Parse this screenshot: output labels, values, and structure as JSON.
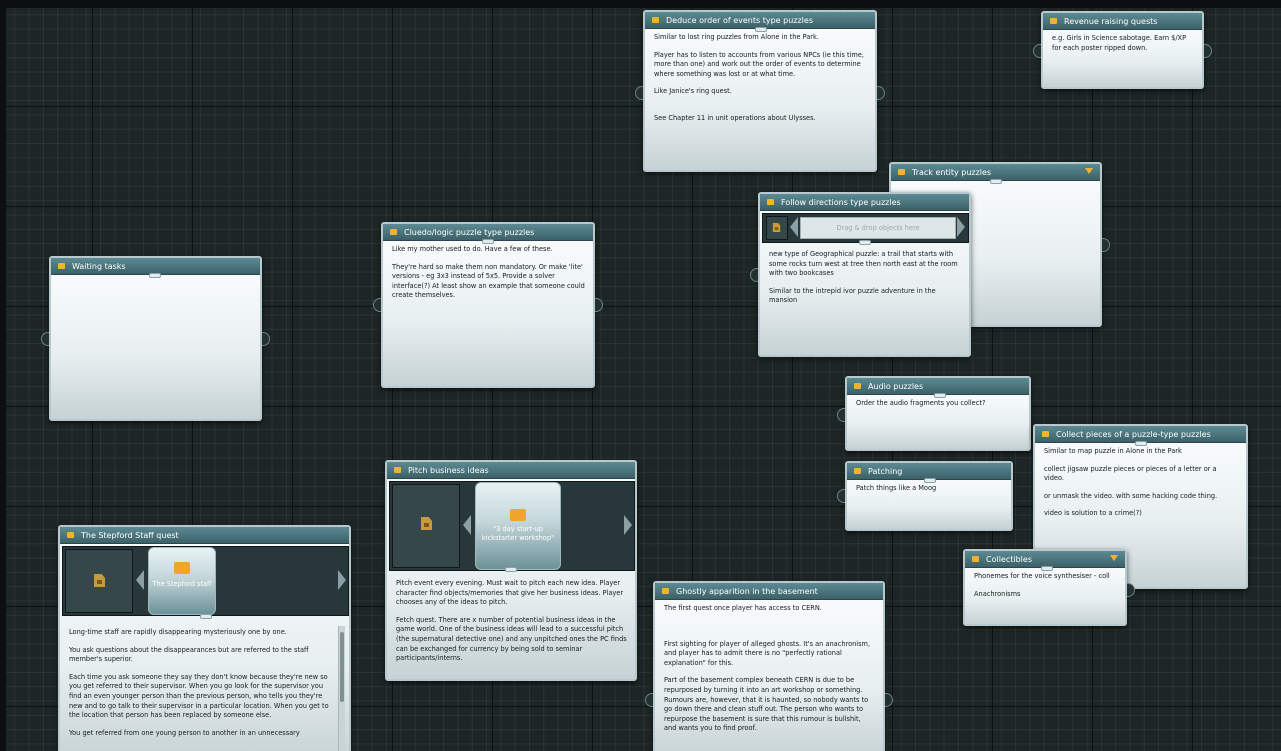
{
  "cards": {
    "waiting": {
      "title": "Waiting tasks"
    },
    "cluedo": {
      "title": "Cluedo/logic puzzle type puzzles",
      "paragraphs": [
        "Like my mother used to do. Have a few of these.",
        "They're hard so make them non mandatory. Or make 'lite' versions - eg 3x3 instead of 5x5. Provide a solver interface(?) At least show an example that someone could create themselves."
      ]
    },
    "deduce": {
      "title": "Deduce order of events type puzzles",
      "paragraphs": [
        "Similar to lost ring puzzles from Alone in the Park.",
        "Player has to listen to accounts from various NPCs (ie this time, more than one) and work out the order of events to determine where something was lost or at what time.",
        "Like Janice's ring quest.",
        "See Chapter 11 in unit operations about Ulysses."
      ]
    },
    "revenue": {
      "title": "Revenue raising quests",
      "paragraphs": [
        "e.g. Girls in Science sabotage. Earn $/XP for each poster ripped down."
      ]
    },
    "track": {
      "title": "Track entity puzzles"
    },
    "follow": {
      "title": "Follow directions type puzzles",
      "dropzone": "Drag & drop objects here",
      "paragraphs": [
        "new type of Geographical puzzle: a trail that starts with some rocks turn west at tree then north east at the room with two bookcases",
        "Similar to the intrepid ivor puzzle adventure in the mansion"
      ]
    },
    "audio": {
      "title": "Audio puzzles",
      "paragraphs": [
        "Order the audio fragments you collect?"
      ]
    },
    "patching": {
      "title": "Patching",
      "paragraphs": [
        "Patch things like a Moog"
      ]
    },
    "collect": {
      "title": "Collect pieces of a puzzle-type puzzles",
      "paragraphs": [
        "Similar to map puzzle in Alone in the Park",
        "collect jigsaw puzzle pieces or pieces of a letter or a video.",
        "or unmask the video. with some hacking code thing.",
        "video is solution to a crime(?)"
      ]
    },
    "collectibles": {
      "title": "Collectibles",
      "paragraphs": [
        "Phonemes for the voice synthesiser - coll",
        "Anachronisms"
      ]
    },
    "pitch": {
      "title": "Pitch business ideas",
      "selected_label": "\"3 day start-up kickstarter workshop\"",
      "paragraphs": [
        "Pitch event every evening. Must wait to pitch each new idea. Player character find objects/memories that give her business ideas. Player chooses any of the ideas to pitch.",
        "Fetch quest. There are x number of potential business ideas in the game world. One of the business ideas will lead to a successful pitch (the supernatural detective one) and any unpitched ones the PC finds can be exchanged for currency by being sold to seminar participants/interns."
      ]
    },
    "stepford": {
      "title": "The Stepford Staff quest",
      "selected_label": "The Stepford staff",
      "paragraphs": [
        "Long-time staff are rapidly disappearing mysteriously one by one.",
        "You ask questions about the disappearances but are referred to the staff member's superior.",
        "Each time you ask someone they say they don't know because they're new so you get referred to their supervisor. When you go look for the supervisor you find an even younger person than the previous person, who tells you they're new and to go talk to their supervisor in a particular location. When you get to the location that person has been replaced by someone else.",
        "You get referred from one young person to another in an unnecessary"
      ]
    },
    "ghostly": {
      "title": "Ghostly apparition in the basement",
      "paragraphs": [
        "The first quest once player has access to CERN.",
        "First sighting for player of alleged ghosts. It's an anachronism, and player has to admit there is no \"perfectly rational explanation\" for this.",
        "Part of the basement complex beneath CERN is due to be repurposed by turning it into an art workshop or something. Rumours are, however, that it is haunted, so nobody wants to go down there and clean stuff out. The person who wants to repurpose the basement is sure that this rumour is bullshit, and wants you to find proof."
      ]
    }
  }
}
